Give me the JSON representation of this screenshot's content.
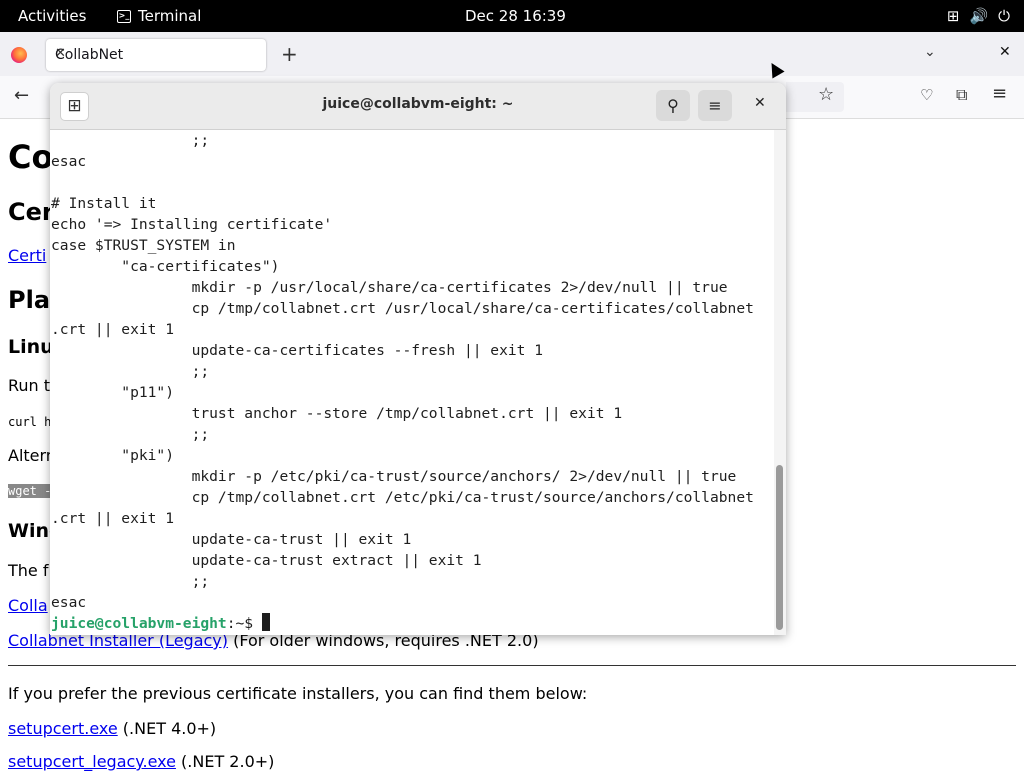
{
  "topbar": {
    "activities": "Activities",
    "app_name": "Terminal",
    "clock": "Dec 28  16:39"
  },
  "browser": {
    "tab_title": "CollabNet",
    "page": {
      "h1": "Co",
      "h2": "Cer",
      "link1": "Certi",
      "h2b": "Pla",
      "h3": "Linu",
      "run": "Run t",
      "curl": "curl h",
      "alt": "Altern",
      "wget": "wget -",
      "h3b": "Wind",
      "the": "The f",
      "link2": "Colla",
      "installer_link": "Collabnet Installer (Legacy)",
      "installer_note": " (For older windows, requires .NET 2.0)",
      "prefer_text": "If you prefer the previous certificate installers, you can find them below:",
      "setupcert_link": "setupcert.exe",
      "setupcert_note": " (.NET 4.0+)",
      "setupcert_legacy_link": "setupcert_legacy.exe",
      "setupcert_legacy_note": " (.NET 2.0+)"
    }
  },
  "terminal": {
    "title": "juice@collabvm-eight: ~",
    "lines": [
      "                ;;",
      "esac",
      "",
      "# Install it",
      "echo '=> Installing certificate'",
      "case $TRUST_SYSTEM in",
      "        \"ca-certificates\")",
      "                mkdir -p /usr/local/share/ca-certificates 2>/dev/null || true",
      "                cp /tmp/collabnet.crt /usr/local/share/ca-certificates/collabnet",
      ".crt || exit 1",
      "                update-ca-certificates --fresh || exit 1",
      "                ;;",
      "        \"p11\")",
      "                trust anchor --store /tmp/collabnet.crt || exit 1",
      "                ;;",
      "        \"pki\")",
      "                mkdir -p /etc/pki/ca-trust/source/anchors/ 2>/dev/null || true",
      "                cp /tmp/collabnet.crt /etc/pki/ca-trust/source/anchors/collabnet",
      ".crt || exit 1",
      "                update-ca-trust || exit 1",
      "                update-ca-trust extract || exit 1",
      "                ;;",
      "esac"
    ],
    "prompt_user": "juice@collabvm-eight",
    "prompt_sep": ":~$ "
  }
}
